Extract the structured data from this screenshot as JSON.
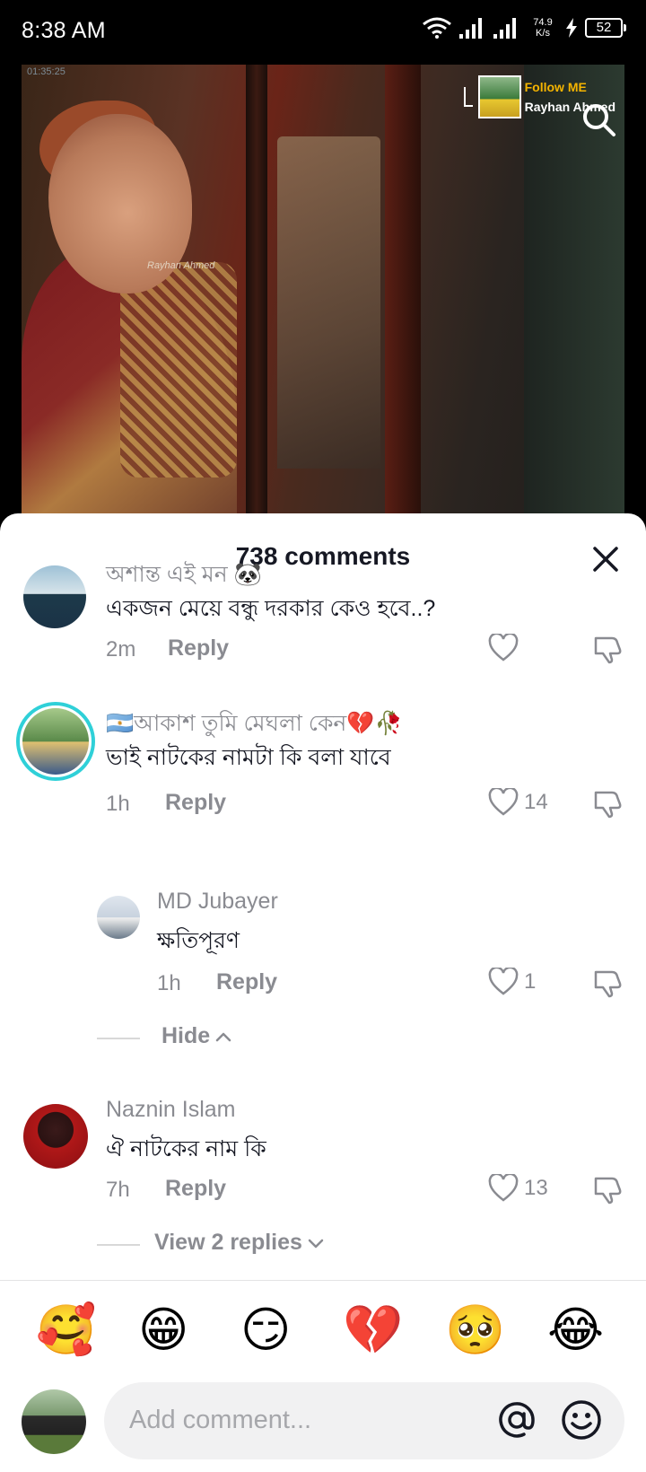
{
  "status_bar": {
    "time": "8:38 AM",
    "net_speed_value": "74.9",
    "net_speed_unit": "K/s",
    "battery": "52"
  },
  "video": {
    "timestamp": "01:35:25",
    "watermark": "Rayhan Ahmed",
    "follow_title": "Follow ME",
    "follow_name": "Rayhan Ahmed"
  },
  "sheet": {
    "title": "738 comments"
  },
  "comments": [
    {
      "username": "অশান্ত এই মন 🐼",
      "text": "একজন মেয়ে বন্ধু দরকার কেও হবে..?",
      "time": "2m",
      "reply_label": "Reply",
      "likes": ""
    },
    {
      "username": "🇦🇷আকাশ তুমি মেঘলা কেন💔🥀",
      "text": "ভাই নাটকের নামটা কি বলা যাবে",
      "time": "1h",
      "reply_label": "Reply",
      "likes": "14"
    },
    {
      "username": "MD Jubayer",
      "text": "ক্ষতিপূরণ",
      "time": "1h",
      "reply_label": "Reply",
      "likes": "1"
    },
    {
      "username": "Naznin Islam",
      "text": "ঐ নাটকের নাম কি",
      "time": "7h",
      "reply_label": "Reply",
      "likes": "13"
    }
  ],
  "threads": {
    "hide_label": "Hide",
    "view_replies_label": "View 2 replies"
  },
  "emojis": [
    "🥰",
    "😁",
    "😏",
    "💔",
    "🥺",
    "😂"
  ],
  "composer": {
    "placeholder": "Add comment..."
  },
  "icons": [
    "wifi-icon",
    "signal-icon",
    "charge-icon",
    "search-icon",
    "close-icon",
    "heart-icon",
    "dislike-icon",
    "chevron-up-icon",
    "chevron-down-icon",
    "at-icon",
    "smile-icon"
  ]
}
